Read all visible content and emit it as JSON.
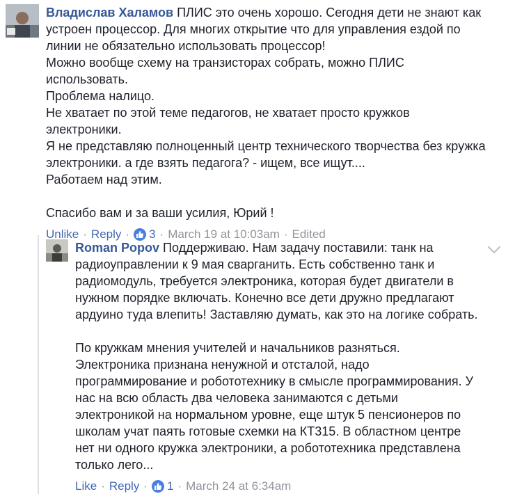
{
  "comment1": {
    "author": "Владислав Халамов",
    "lines": [
      "ПЛИС это очень хорошо. Сегодня дети не знают как",
      "устроен процессор. Для многих открытие что для управления ездой по",
      "линии не обязательно использовать процессор!",
      "Можно вообще схему на транзисторах собрать, можно ПЛИС",
      "использовать.",
      "Проблема налицо.",
      "Не хватает по этой теме педагогов, не хватает просто кружков",
      "электроники.",
      "Я не представляю полноценный центр технического творчества без кружка",
      "электроники. а где взять педагога? - ищем, все ищут....",
      "Работаем над этим.",
      "",
      "Спасибо вам и за ваши усилия, Юрий !"
    ],
    "actions": {
      "like": "Unlike",
      "reply": "Reply",
      "sep": "·",
      "reactions": "3",
      "time": "March 19 at 10:03am",
      "edited": "Edited"
    }
  },
  "comment2": {
    "author": "Roman Popov",
    "lines": [
      "Поддерживаю. Нам задачу поставили: танк на",
      "радиоуправлении к 9 мая сварганить. Есть собственно танк и",
      "радиомодуль, требуется электроника, которая будет двигатели в",
      "нужном порядке включать. Конечно все дети дружно предлагают",
      "ардуино туда влепить! Заставляю думать, как это на логике собрать.",
      "",
      "По кружкам мнения учителей и начальников разняться.",
      "Электроника признана ненужной и отсталой, надо",
      "программирование и робототехнику в смысле программирования. У",
      "нас на всю область два человека занимаются с детьми",
      "электроникой на нормальном уровне, еще штук 5 пенсионеров по",
      "школам учат паять готовые схемки на КТ315. В областном центре",
      "нет ни одного кружка электроники, а робототехника представлена",
      "только лего..."
    ],
    "actions": {
      "like": "Like",
      "reply": "Reply",
      "sep": "·",
      "reactions": "1",
      "time": "March 24 at 6:34am"
    }
  },
  "icons": {
    "like_badge": "thumbs-up-icon",
    "menu": "chevron-down-icon"
  },
  "colors": {
    "link": "#4267b2",
    "author": "#365899",
    "meta": "#90949c",
    "like_badge": "#4a7fe0"
  }
}
